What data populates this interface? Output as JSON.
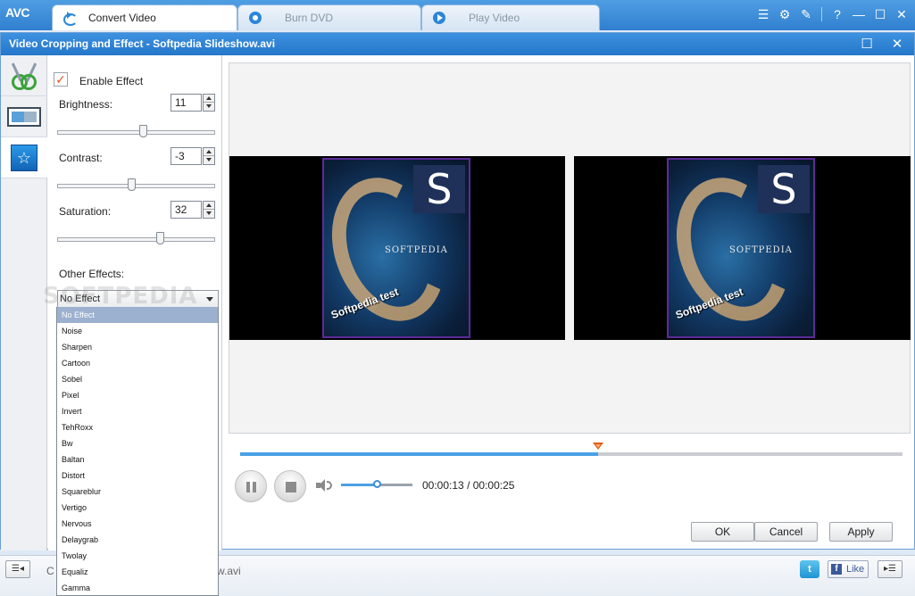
{
  "app": {
    "logo": "AVC",
    "tabs": [
      {
        "label": "Convert Video",
        "active": true,
        "icon": "convert-icon"
      },
      {
        "label": "Burn DVD",
        "active": false,
        "icon": "disc-icon"
      },
      {
        "label": "Play Video",
        "active": false,
        "icon": "play-icon"
      }
    ],
    "window_buttons": {
      "help": "?",
      "minimize": "—",
      "maximize": "☐",
      "close": "✕"
    }
  },
  "dialog": {
    "title": "Video Cropping and Effect - Softpedia Slideshow.avi",
    "nav": [
      "crop-icon",
      "trim-icon",
      "effect-icon"
    ],
    "enable_effect": {
      "label": "Enable Effect",
      "checked": true
    },
    "brightness": {
      "label": "Brightness:",
      "value": "11",
      "slider": 0.55
    },
    "contrast": {
      "label": "Contrast:",
      "value": "-3",
      "slider": 0.47
    },
    "saturation": {
      "label": "Saturation:",
      "value": "32",
      "slider": 0.66
    },
    "other_effects": {
      "label": "Other Effects:",
      "selected": "No Effect",
      "options": [
        "No Effect",
        "Noise",
        "Sharpen",
        "Cartoon",
        "Sobel",
        "Pixel",
        "Invert",
        "TehRoxx",
        "Bw",
        "Baltan",
        "Distort",
        "Squareblur",
        "Vertigo",
        "Nervous",
        "Delaygrab",
        "Twolay",
        "Equaliz",
        "Gamma"
      ]
    },
    "watermark": "SOFTPEDIA",
    "preview": {
      "brand_text": "SOFTPEDIA",
      "logo_letter": "S",
      "caption": "Softpedia test"
    },
    "playback": {
      "progress": 0.54,
      "volume": 0.52,
      "current_time": "00:00:13",
      "total_time": "00:00:25"
    },
    "buttons": {
      "ok": "OK",
      "cancel": "Cancel",
      "apply": "Apply"
    }
  },
  "bottom": {
    "partial_left": "C",
    "partial_file": "w.avi",
    "like": "Like",
    "twitter": "t",
    "facebook": "f"
  },
  "colors": {
    "accent": "#2f7fcf",
    "title_bar": "#3d92e0",
    "selection": "#9cb0cf",
    "progress": "#49a1e6"
  }
}
